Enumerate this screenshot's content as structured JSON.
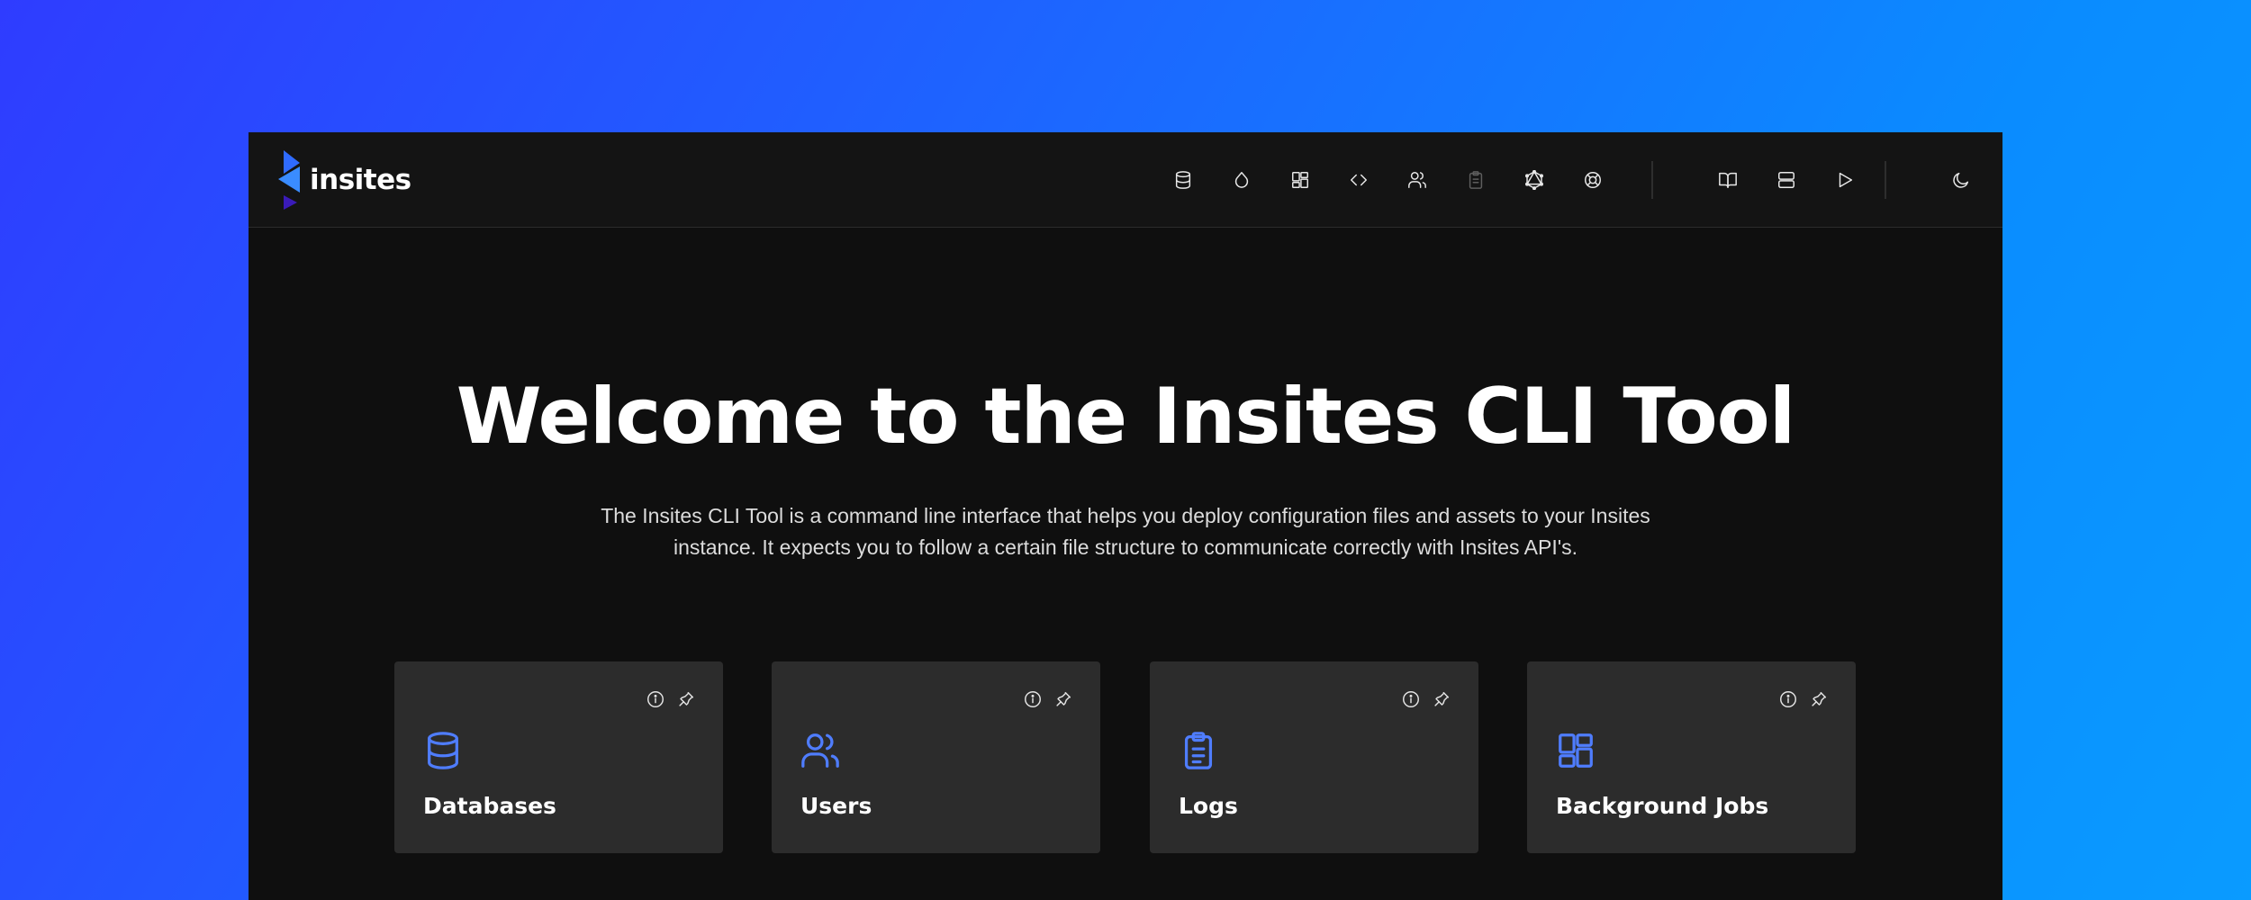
{
  "brand": {
    "name": "insites"
  },
  "nav": {
    "items": [
      {
        "icon": "database-icon",
        "name": "nav-databases"
      },
      {
        "icon": "droplet-icon",
        "name": "nav-assets"
      },
      {
        "icon": "layout-dashboard-icon",
        "name": "nav-background-jobs"
      },
      {
        "icon": "code-icon",
        "name": "nav-code"
      },
      {
        "icon": "users-icon",
        "name": "nav-users"
      },
      {
        "icon": "clipboard-icon",
        "name": "nav-logs"
      },
      {
        "icon": "graphql-icon",
        "name": "nav-graphql"
      },
      {
        "icon": "life-buoy-icon",
        "name": "nav-support"
      },
      {
        "icon": "book-open-icon",
        "name": "nav-docs"
      },
      {
        "icon": "server-icon",
        "name": "nav-instances"
      },
      {
        "icon": "play-icon",
        "name": "nav-run"
      },
      {
        "icon": "moon-icon",
        "name": "nav-theme-toggle"
      }
    ]
  },
  "hero": {
    "title": "Welcome to the Insites CLI Tool",
    "description": "The Insites CLI Tool is a command line interface that helps you deploy configuration files and assets to your Insites instance. It expects you to follow a certain file structure to communicate correctly with Insites API's."
  },
  "cards": [
    {
      "title": "Databases",
      "icon": "database-icon"
    },
    {
      "title": "Users",
      "icon": "users-icon"
    },
    {
      "title": "Logs",
      "icon": "clipboard-list-icon"
    },
    {
      "title": "Background Jobs",
      "icon": "layout-dashboard-icon"
    }
  ],
  "colors": {
    "accent": "#4f7dff",
    "window_bg": "#0f0f0f",
    "topbar_bg": "#141414",
    "card_bg": "#2c2c2c"
  }
}
